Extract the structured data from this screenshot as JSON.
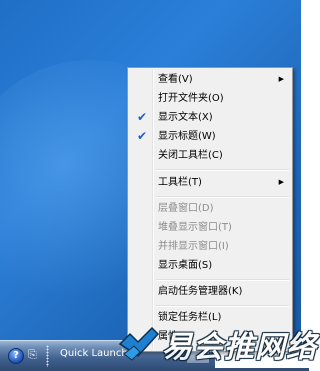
{
  "taskbar": {
    "help_glyph": "?",
    "clipboard_glyph": "⎘",
    "quick_launch_label": "Quick Launch"
  },
  "context_menu": {
    "items": [
      {
        "label": "查看(V)",
        "has_submenu": true,
        "checked": false,
        "enabled": true
      },
      {
        "label": "打开文件夹(O)",
        "has_submenu": false,
        "checked": false,
        "enabled": true
      },
      {
        "label": "显示文本(X)",
        "has_submenu": false,
        "checked": true,
        "enabled": true
      },
      {
        "label": "显示标题(W)",
        "has_submenu": false,
        "checked": true,
        "enabled": true
      },
      {
        "label": "关闭工具栏(C)",
        "has_submenu": false,
        "checked": false,
        "enabled": true
      },
      {
        "label": "工具栏(T)",
        "has_submenu": true,
        "checked": false,
        "enabled": true
      },
      {
        "label": "层叠窗口(D)",
        "has_submenu": false,
        "checked": false,
        "enabled": false
      },
      {
        "label": "堆叠显示窗口(T)",
        "has_submenu": false,
        "checked": false,
        "enabled": false
      },
      {
        "label": "并排显示窗口(I)",
        "has_submenu": false,
        "checked": false,
        "enabled": false
      },
      {
        "label": "显示桌面(S)",
        "has_submenu": false,
        "checked": false,
        "enabled": true
      },
      {
        "label": "启动任务管理器(K)",
        "has_submenu": false,
        "checked": false,
        "enabled": true
      },
      {
        "label": "锁定任务栏(L)",
        "has_submenu": false,
        "checked": false,
        "enabled": true
      },
      {
        "label": "属性",
        "has_submenu": false,
        "checked": false,
        "enabled": true
      }
    ],
    "check_glyph": "✔",
    "submenu_arrow_glyph": "▶"
  },
  "watermark": {
    "text": "易会推网络",
    "logo_icon": "checkmark-logo-icon"
  },
  "colors": {
    "desktop_blue": "#1f6fc6",
    "menu_background": "#f0f0f0",
    "check_blue": "#1f5ec9",
    "disabled_text": "#8c8c8c"
  }
}
